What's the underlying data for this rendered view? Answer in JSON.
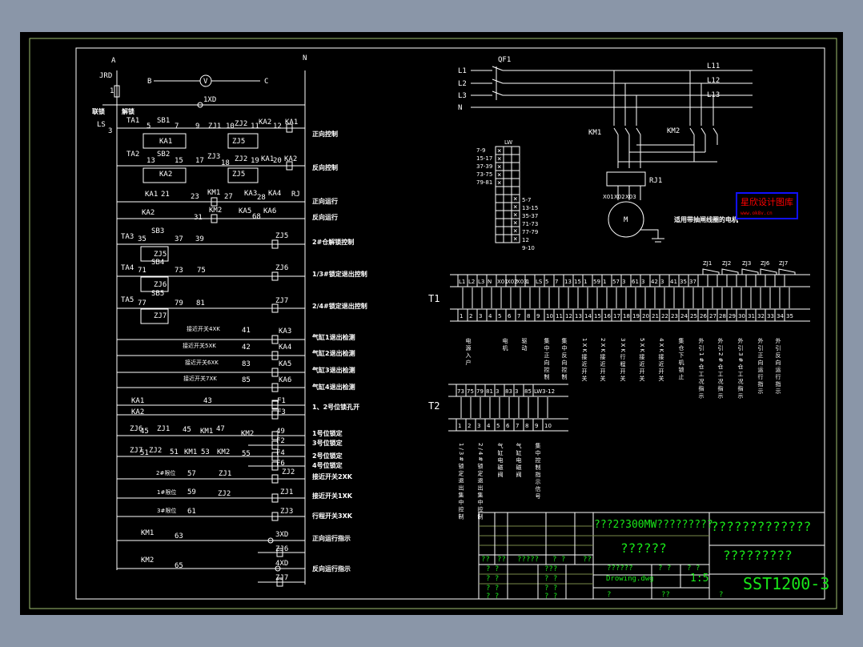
{
  "colors": {
    "viewer_bg": "#8a96a8",
    "canvas": "#000000",
    "line": "#ffffff",
    "title_text": "#19e619",
    "border_outer": "#a0c070",
    "watermark": "#ff0000",
    "watermark_frame": "#1010ff"
  },
  "ladder": {
    "rail_left": "A",
    "rail_right": "N",
    "fuse": "JRD",
    "fuse_no": "1",
    "volt_left": "B",
    "volt_right": "C",
    "volt_symbol": "V",
    "lamp": "1XD",
    "interlock": "联锁",
    "unlock": "解锁",
    "ls": "LS",
    "ls_no": "3",
    "rungs": [
      {
        "texts": [
          "TA1",
          "5",
          "SB1",
          "7",
          "KA1",
          "9",
          "ZJ1",
          "10",
          "ZJ2",
          "11",
          "ZJ5",
          "KA2",
          "12",
          "KA1"
        ],
        "labels": [
          "正向控制"
        ]
      },
      {
        "texts": [
          "TA2",
          "13",
          "SB2",
          "15",
          "KA2",
          "17",
          "ZJ3",
          "18",
          "ZJ2",
          "19",
          "ZJ5",
          "KA1",
          "20",
          "KA2"
        ],
        "labels": [
          "反向控制"
        ]
      },
      {
        "texts": [
          "KA1",
          "21",
          "23",
          "KM1",
          "27",
          "KA3",
          "28",
          "KA4",
          "RJ"
        ],
        "labels": [
          "正向运行"
        ]
      },
      {
        "texts": [
          "KA2",
          "31",
          "KM2",
          "KA5",
          "68",
          "KA6"
        ],
        "labels": [
          "反向运行"
        ]
      },
      {
        "texts": [
          "TA3",
          "35",
          "SB3",
          "37",
          "ZJ5",
          "39",
          "ZJ5"
        ],
        "labels": [
          "2#仓解锁控制"
        ]
      },
      {
        "texts": [
          "TA4",
          "71",
          "SB4",
          "73",
          "ZJ6",
          "75",
          "ZJ6"
        ],
        "labels": [
          "1/3#锁定退出控制"
        ]
      },
      {
        "texts": [
          "TA5",
          "77",
          "SB5",
          "79",
          "ZJ7",
          "81",
          "ZJ7"
        ],
        "labels": [
          "2/4#锁定退出控制"
        ]
      },
      {
        "texts": [
          "接近开关4XK",
          "41",
          "KA3"
        ],
        "labels": [
          "气缸1退出检测"
        ]
      },
      {
        "texts": [
          "接近开关5XK",
          "42",
          "KA4"
        ],
        "labels": [
          "气缸2退出检测"
        ]
      },
      {
        "texts": [
          "接近开关6XK",
          "83",
          "KA5"
        ],
        "labels": [
          "气缸3退出检测"
        ]
      },
      {
        "texts": [
          "接近开关7XK",
          "85",
          "KA6"
        ],
        "labels": [
          "气缸4退出检测"
        ]
      },
      {
        "texts": [
          "KA1",
          "43",
          "F1",
          "KA2",
          "F3"
        ],
        "labels": [
          "1、2号位锁孔开"
        ]
      },
      {
        "texts": [
          "ZJ6",
          "45",
          "ZJ1",
          "45",
          "KM1",
          "47",
          "KM2",
          "49",
          "F2",
          "F5"
        ],
        "labels": [
          "1号位锁定",
          "3号位锁定"
        ]
      },
      {
        "texts": [
          "ZJ7",
          "51",
          "ZJ2",
          "51",
          "KM1",
          "53",
          "KM2",
          "55",
          "F4",
          "F6"
        ],
        "labels": [
          "2号位锁定",
          "4号位锁定"
        ]
      },
      {
        "texts": [
          "2#限位",
          "57",
          "ZJ1",
          "ZJ2"
        ],
        "labels": [
          "接近开关2XK"
        ]
      },
      {
        "texts": [
          "1#限位",
          "59",
          "ZJ2",
          "ZJ1"
        ],
        "labels": [
          "接近开关1XK"
        ]
      },
      {
        "texts": [
          "3#限位",
          "61",
          "ZJ3"
        ],
        "labels": [
          "行程开关3XK"
        ]
      },
      {
        "texts": [
          "KM1",
          "63",
          "3XD",
          "ZJ6"
        ],
        "labels": [
          "正向运行指示"
        ]
      },
      {
        "texts": [
          "KM2",
          "65",
          "4XD",
          "ZJ7"
        ],
        "labels": [
          "反向运行指示"
        ]
      }
    ]
  },
  "power": {
    "inputs": [
      "L1",
      "L2",
      "L3",
      "N"
    ],
    "breaker": "QF1",
    "outputs": [
      "L11",
      "L12",
      "L13"
    ],
    "contactors": [
      "KM1",
      "KM2"
    ],
    "relay": "RJ1",
    "motor_terminals": [
      "X01",
      "X02",
      "X03"
    ],
    "motor": "M",
    "caption": "适用带抽闸线圈的电机"
  },
  "switch_table": {
    "header": "LW",
    "left_rows": [
      "7-9",
      "15-17",
      "37-39",
      "73-75",
      "79-81"
    ],
    "right_rows": [
      "5-7",
      "13-15",
      "35-37",
      "71-73",
      "77-79",
      "12",
      "9-10"
    ],
    "mark": "×"
  },
  "watermark": {
    "title": "星欣设计图库",
    "url": "www.ok8v.cn"
  },
  "t1": {
    "name": "T1",
    "top": [
      "L1",
      "L2",
      "L3",
      "N",
      "X01",
      "X02",
      "X03",
      "1",
      "LS",
      "5",
      "7",
      "13",
      "15",
      "1",
      "59",
      "1",
      "57",
      "3",
      "61",
      "3",
      "42",
      "3",
      "41",
      "35",
      "37",
      "",
      "",
      "",
      "",
      "",
      "",
      "",
      "",
      "",
      ""
    ],
    "bottom": [
      "1",
      "2",
      "3",
      "4",
      "5",
      "6",
      "7",
      "8",
      "9",
      "10",
      "11",
      "12",
      "13",
      "14",
      "15",
      "16",
      "17",
      "18",
      "19",
      "20",
      "21",
      "22",
      "23",
      "24",
      "25",
      "26",
      "27",
      "28",
      "29",
      "30",
      "31",
      "32",
      "33",
      "34",
      "35"
    ],
    "relays": [
      "ZJ1",
      "ZJ2",
      "ZJ3",
      "ZJ6",
      "ZJ7"
    ],
    "descriptions": [
      "电源入户",
      "电机",
      "驱动",
      "集中正向控制",
      "集中反向控制",
      "1XK接近开关",
      "2XK接近开关",
      "3XK行程开关",
      "5XK接近开关",
      "4XK接近开关",
      "集仓下机锁止",
      "外引1#仓工况指示",
      "外引2#仓工况指示",
      "外引3#仓工况指示",
      "外引正向运行指示",
      "外引反向运行指示"
    ]
  },
  "t2": {
    "name": "T2",
    "top": [
      "73",
      "75",
      "79",
      "81",
      "3",
      "83",
      "3",
      "85",
      "LW3-12"
    ],
    "bottom": [
      "1",
      "2",
      "3",
      "4",
      "5",
      "6",
      "7",
      "8",
      "9",
      "10"
    ],
    "descriptions": [
      "1/3#锁定退出集中控制",
      "2/4#锁定退出集中控制",
      "气缸电磁阀",
      "气缸电磁阀",
      "集中控制指示信号"
    ]
  },
  "title_block": {
    "project": "???2?300MW?????????",
    "drawing_title": "??????",
    "company": "?????????????",
    "dept": "?????????",
    "file_label": "??????",
    "c1": "? ?",
    "c2": "? ?",
    "file": "Drowing.dwg",
    "scale": "1:5",
    "sheet": "?",
    "total": "??",
    "num_label": "?",
    "drawing_no": "SST1200-3",
    "grid_labels": [
      "??",
      "??",
      "?????",
      "? ?",
      "??"
    ],
    "grid_cells": [
      "? ?",
      "???",
      "? ?",
      "? ?",
      "? ?",
      "? ?",
      "? ?",
      "? ?"
    ]
  }
}
